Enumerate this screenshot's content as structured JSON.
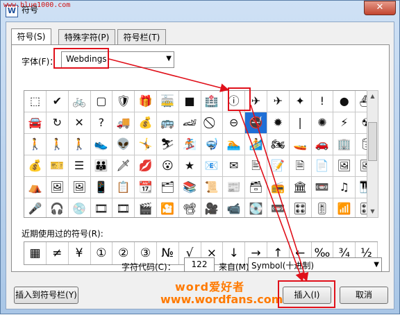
{
  "window": {
    "title": "符号",
    "watermark": "www.blue1000.com",
    "app_icon": "W",
    "close_glyph": "✕"
  },
  "tabs": [
    {
      "label": "符号(S)",
      "active": true
    },
    {
      "label": "特殊字符(P)",
      "active": false
    },
    {
      "label": "符号栏(T)",
      "active": false
    }
  ],
  "font": {
    "label": "字体(F)：",
    "value": "Webdings"
  },
  "symbol_grid": {
    "rows": [
      [
        "⬚",
        "✔",
        "🚲",
        "▢",
        "🛡",
        "🎁",
        "🚋",
        "■",
        "🏥",
        "ⓘ",
        "✈",
        "✈",
        "✦",
        "!",
        "●",
        "⛴"
      ],
      [
        "🚘",
        "↻",
        "✕",
        "?",
        "🚚",
        "💰",
        "🚌",
        "🏎",
        "⃠",
        "⊖",
        "🚭",
        "✹",
        "|",
        "✺",
        "⚡",
        "☢"
      ],
      [
        "🚶",
        "🚶",
        "🚶",
        "👟",
        "👽",
        "🤸",
        "⛷",
        "🏂",
        "🤿",
        "🏊",
        "🏄",
        "🏍",
        "🚤",
        "🚗",
        "🏢",
        "🛢"
      ],
      [
        "💰",
        "🎫",
        "☰",
        "👪",
        "🗡",
        "💋",
        "😮",
        "★",
        "📧",
        "✉",
        "🖹",
        "📝",
        "🗎",
        "📄",
        "🖼",
        "🖼"
      ],
      [
        "⛺",
        "🖼",
        "🖼",
        "📱",
        "📋",
        "📆",
        "🗂",
        "📚",
        "📜",
        "📰",
        "🗃",
        "📻",
        "🏛",
        "📼",
        "♫",
        "🎹"
      ],
      [
        "🎤",
        "🎧",
        "💿",
        "🎞",
        "🎞",
        "🎬",
        "🎦",
        "📽",
        "🎥",
        "📹",
        "💽",
        "📼",
        "🎛",
        "🎚",
        "📶",
        "🎛"
      ]
    ]
  },
  "recent": {
    "label": "近期使用过的符号(R):",
    "symbols": [
      "▦",
      "≠",
      "¥",
      "①",
      "②",
      "③",
      "№",
      "√",
      "×",
      "↓",
      "→",
      "↑",
      "←",
      "‰",
      "¾",
      "½"
    ]
  },
  "char_code": {
    "label": "字符代码(C)：",
    "value": "122"
  },
  "from": {
    "label": "来自(M)",
    "value": "Symbol(十进制)"
  },
  "buttons": {
    "insert_to_bar": "插入到符号栏(Y)",
    "insert": "插入(I)",
    "cancel": "取消"
  },
  "brand": {
    "line1": "word爱好者",
    "line2": "www.wordfans.com"
  },
  "colors": {
    "highlight": "#e0101a",
    "selection": "#1f6fd6",
    "brand": "#ff7a00"
  }
}
